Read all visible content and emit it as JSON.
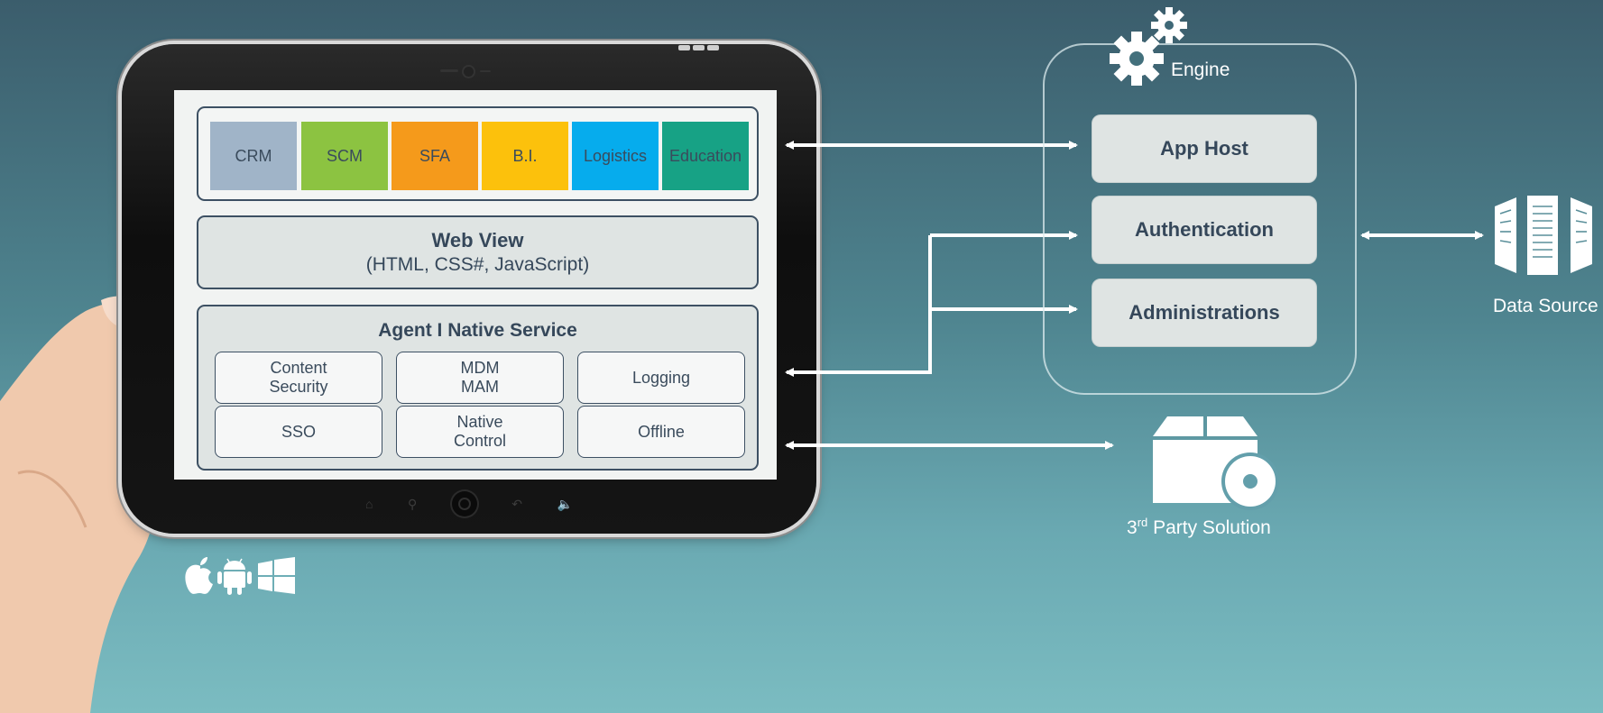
{
  "modules": [
    {
      "label": "CRM",
      "color": "#a0b4c8"
    },
    {
      "label": "SCM",
      "color": "#8cc341"
    },
    {
      "label": "SFA",
      "color": "#f59a1b"
    },
    {
      "label": "B.I.",
      "color": "#fcc10c"
    },
    {
      "label": "Logistics",
      "color": "#06aced"
    },
    {
      "label": "Education",
      "color": "#17a285"
    }
  ],
  "webview": {
    "title": "Web View",
    "subtitle": "(HTML, CSS#, JavaScript)"
  },
  "agent": {
    "title": "Agent I Native Service",
    "services": [
      "Content\nSecurity",
      "MDM\nMAM",
      "Logging",
      "SSO",
      "Native\nControl",
      "Offline"
    ]
  },
  "engine": {
    "label": "Engine",
    "boxes": [
      "App Host",
      "Authentication",
      "Administrations"
    ]
  },
  "data_source": {
    "label": "Data Source"
  },
  "third_party": {
    "prefix": "3",
    "superscript": "rd",
    "label": " Party Solution"
  },
  "os_platforms": [
    "apple-icon",
    "android-icon",
    "windows-icon"
  ]
}
